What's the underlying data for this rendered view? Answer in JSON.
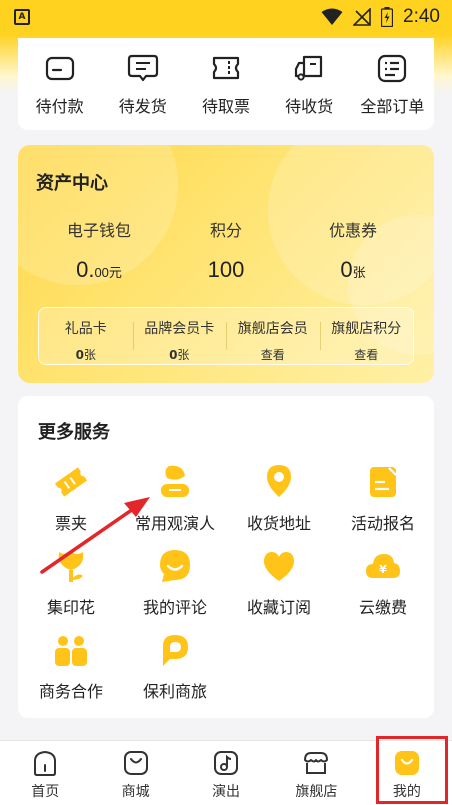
{
  "status_bar": {
    "time": "2:40",
    "app_icon": "A",
    "icons": [
      "wifi-icon",
      "no-signal-icon",
      "battery-charging-icon"
    ]
  },
  "orders": [
    {
      "label": "待付款",
      "icon": "wallet-card-icon"
    },
    {
      "label": "待发货",
      "icon": "message-box-icon"
    },
    {
      "label": "待取票",
      "icon": "ticket-icon"
    },
    {
      "label": "待收货",
      "icon": "truck-icon"
    },
    {
      "label": "全部订单",
      "icon": "order-list-icon"
    }
  ],
  "assets": {
    "title": "资产中心",
    "wallet": {
      "label": "电子钱包",
      "value": "0.",
      "cents": "00",
      "unit": "元"
    },
    "points": {
      "label": "积分",
      "value": "100"
    },
    "coupons": {
      "label": "优惠券",
      "value": "0",
      "unit": "张"
    },
    "sub": [
      {
        "label": "礼品卡",
        "value": "0",
        "unit": "张"
      },
      {
        "label": "品牌会员卡",
        "value": "0",
        "unit": "张"
      },
      {
        "label": "旗舰店会员",
        "value": "查看"
      },
      {
        "label": "旗舰店积分",
        "value": "查看"
      }
    ]
  },
  "services": {
    "title": "更多服务",
    "items": [
      {
        "label": "票夹",
        "icon": "ticket-holder-icon"
      },
      {
        "label": "常用观演人",
        "icon": "audience-person-icon"
      },
      {
        "label": "收货地址",
        "icon": "location-pin-icon"
      },
      {
        "label": "活动报名",
        "icon": "signup-form-icon"
      },
      {
        "label": "集印花",
        "icon": "flower-stamp-icon"
      },
      {
        "label": "我的评论",
        "icon": "comment-icon"
      },
      {
        "label": "收藏订阅",
        "icon": "heart-icon"
      },
      {
        "label": "云缴费",
        "icon": "cloud-payment-icon"
      },
      {
        "label": "商务合作",
        "icon": "business-cooperation-icon"
      },
      {
        "label": "保利商旅",
        "icon": "poly-travel-icon"
      }
    ]
  },
  "tabs": [
    {
      "label": "首页",
      "icon": "home-icon"
    },
    {
      "label": "商城",
      "icon": "shopping-bag-icon"
    },
    {
      "label": "演出",
      "icon": "music-note-icon"
    },
    {
      "label": "旗舰店",
      "icon": "storefront-icon"
    },
    {
      "label": "我的",
      "icon": "profile-face-icon",
      "active": true
    }
  ],
  "colors": {
    "accent": "#ffd21f",
    "icon_yellow": "#ffc417",
    "annotation_red": "#e3262a"
  }
}
